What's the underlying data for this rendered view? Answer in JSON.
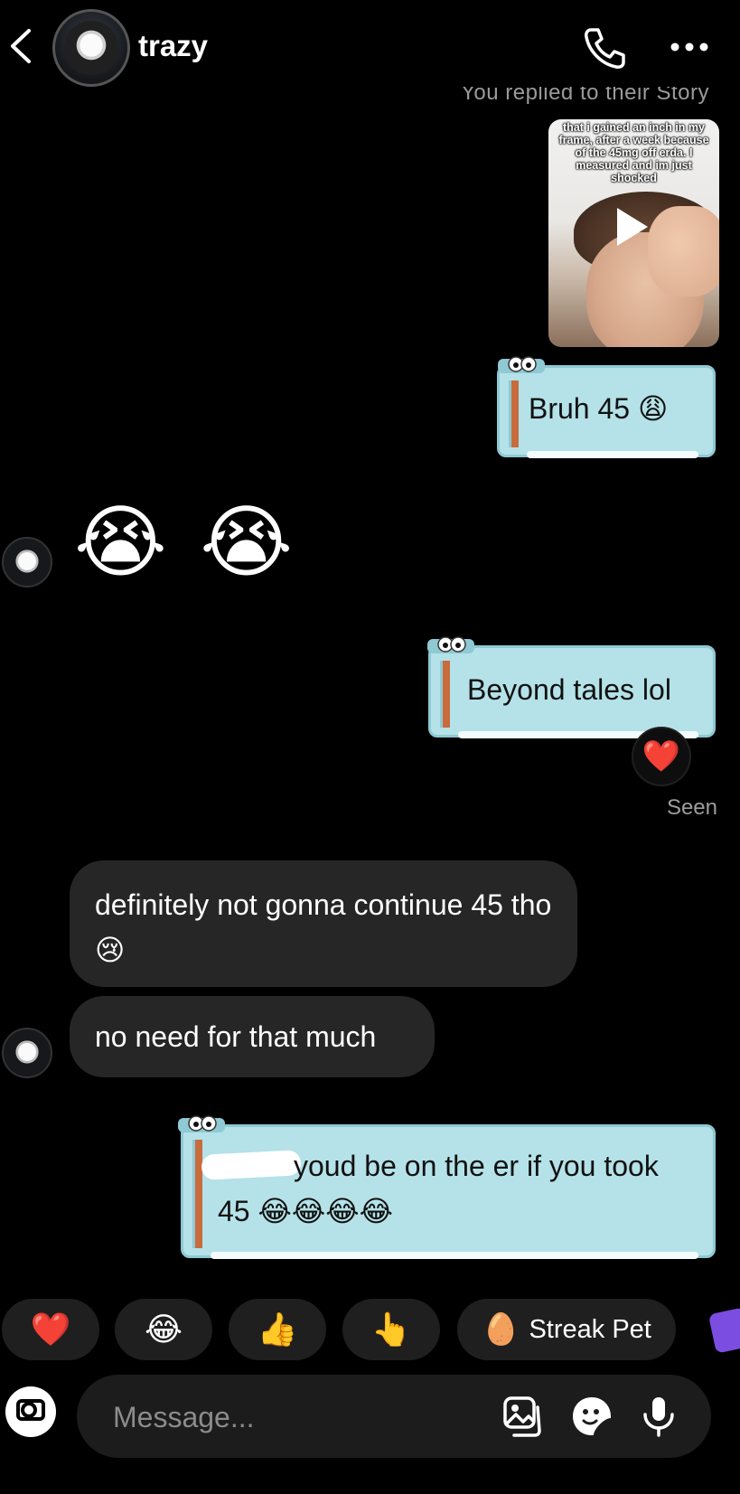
{
  "header": {
    "username": "trazy",
    "icons": {
      "back": "chevron-left-icon",
      "call": "phone-icon",
      "more": "more-horizontal-icon"
    }
  },
  "story_reply": {
    "note": "You replied to their Story",
    "caption": "that i gained an inch in my frame, after a week because of the 45mg off erda. I measured and im just shocked"
  },
  "messages": [
    {
      "from": "me",
      "text": "Bruh 45 😩"
    },
    {
      "from": "them",
      "text": "😭 😭"
    },
    {
      "from": "me",
      "text": "Beyond tales lol",
      "reaction": "❤️"
    },
    {
      "from": "them",
      "text": "definitely not gonna continue 45 tho😢"
    },
    {
      "from": "them",
      "text": "no need for that much"
    },
    {
      "from": "me",
      "text": "youd be on the er if you took 45 😂😂😂😂",
      "prefix_redacted": true
    }
  ],
  "status": {
    "seen": "Seen"
  },
  "quick_reactions": [
    "❤️",
    "😂",
    "👍",
    "👆",
    "Streak Pet"
  ],
  "streak_pet_icon": "🥚",
  "composer": {
    "placeholder": "Message...",
    "icons": [
      "camera-icon",
      "gallery-icon",
      "sticker-icon",
      "microphone-icon"
    ]
  },
  "colors": {
    "background": "#000000",
    "bubble_out": "#b4e2e8",
    "bubble_in": "#262626",
    "chip": "#1f1f1f",
    "accent_stripe": "#c86b3d"
  }
}
